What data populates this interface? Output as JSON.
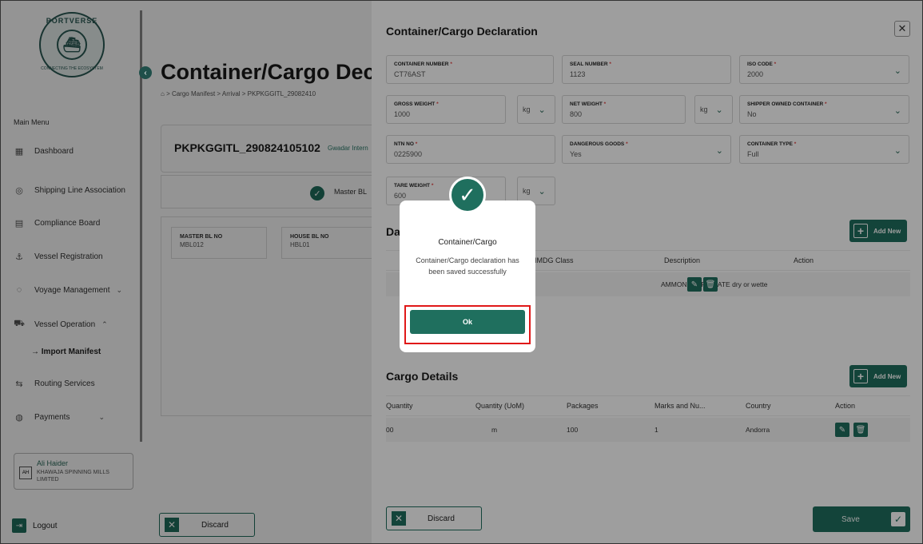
{
  "sidebar": {
    "logo_text": "PORTVERSE",
    "logo_tagline": "CONNECTING THE ECOSYSTEM",
    "main_menu_label": "Main Menu",
    "items": [
      {
        "label": "Dashboard",
        "icon": "dashboard-icon"
      },
      {
        "label": "Shipping Line Association",
        "icon": "association-icon"
      },
      {
        "label": "Compliance Board",
        "icon": "compliance-icon"
      },
      {
        "label": "Vessel Registration",
        "icon": "vessel-icon"
      },
      {
        "label": "Voyage Management",
        "icon": "voyage-icon"
      },
      {
        "label": "Vessel Operation",
        "icon": "operation-icon"
      },
      {
        "label": "Routing Services",
        "icon": "routing-icon"
      },
      {
        "label": "Payments",
        "icon": "payments-icon"
      }
    ],
    "sub_item": "Import Manifest",
    "user": {
      "initials": "AH",
      "name": "Ali Haider",
      "company": "KHAWAJA SPINNING MILLS LIMITED"
    },
    "logout_label": "Logout"
  },
  "background": {
    "title": "Container/Cargo Dec",
    "breadcrumb": "> Cargo Manifest > Arrival > PKPKGGITL_29082410",
    "bl_id": "PKPKGGITL_290824105102",
    "port": "Gwadar Intern",
    "step_label": "Master BL",
    "fields": [
      {
        "label": "MASTER BL NO",
        "value": "MBL012"
      },
      {
        "label": "HOUSE BL NO",
        "value": "HBL01"
      }
    ],
    "discard_label": "Discard"
  },
  "drawer": {
    "title": "Container/Cargo Declaration",
    "fields": {
      "container_number": {
        "label": "CONTAINER NUMBER",
        "value": "CT76AST"
      },
      "seal_number": {
        "label": "SEAL NUMBER",
        "value": "1123"
      },
      "iso_code": {
        "label": "ISO CODE",
        "value": "2000"
      },
      "gross_weight": {
        "label": "GROSS WEIGHT",
        "value": "1000",
        "unit": "kg"
      },
      "net_weight": {
        "label": "NET WEIGHT",
        "value": "800",
        "unit": "kg"
      },
      "shipper_owned": {
        "label": "SHIPPER OWNED CONTAINER",
        "value": "No"
      },
      "ntn_no": {
        "label": "NTN NO",
        "value": "0225900"
      },
      "dangerous_goods": {
        "label": "DANGEROUS GOODS",
        "value": "Yes"
      },
      "container_type": {
        "label": "CONTAINER TYPE",
        "value": "Full"
      },
      "tare_weight": {
        "label": "TARE WEIGHT",
        "value": "600",
        "unit": "kg"
      }
    },
    "required_mark": "*",
    "dg_section": {
      "title_partial": "Da",
      "add_new": "Add New",
      "headers": [
        "IMDG Class",
        "Description",
        "Action"
      ],
      "row": {
        "description": "AMMONIUM PICRATE dry or wette"
      }
    },
    "cargo_section": {
      "title": "Cargo Details",
      "add_new": "Add New",
      "headers": [
        "Quantity",
        "Quantity (UoM)",
        "Packages",
        "Marks and Nu...",
        "Country",
        "Action"
      ],
      "row": [
        "00",
        "m",
        "100",
        "1",
        "Andorra"
      ]
    },
    "discard_label": "Discard",
    "save_label": "Save"
  },
  "modal": {
    "title": "Container/Cargo",
    "message": "Container/Cargo declaration has been saved successfully",
    "ok_label": "Ok"
  },
  "colors": {
    "primary": "#1f6f5e",
    "highlight": "#e01818",
    "required": "#e04040"
  }
}
